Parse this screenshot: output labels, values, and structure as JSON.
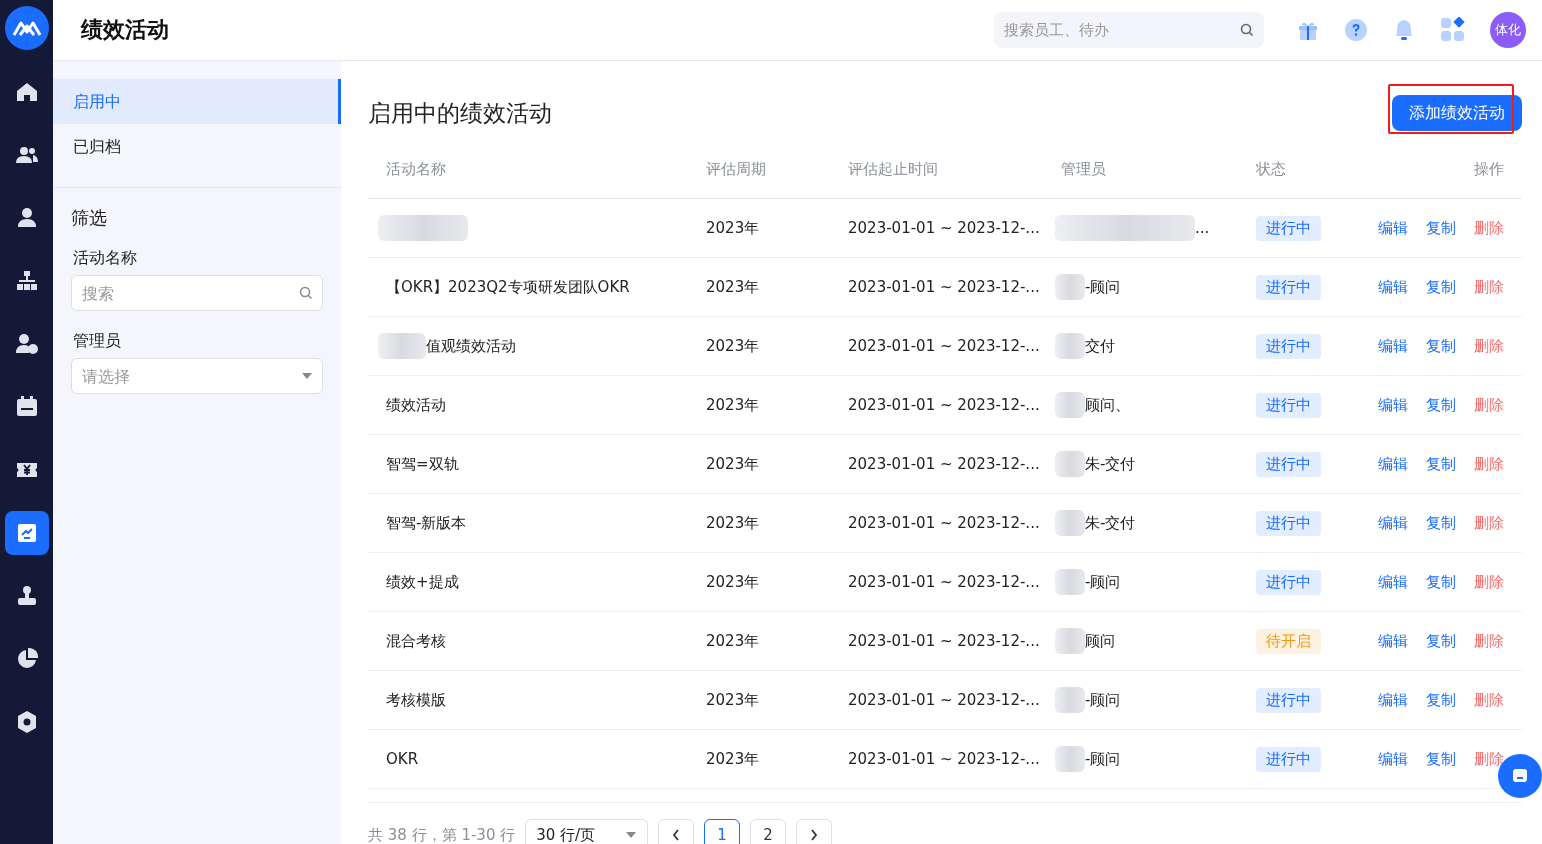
{
  "nav": [
    {
      "kind": "home",
      "selected": false
    },
    {
      "kind": "team",
      "selected": false
    },
    {
      "kind": "person",
      "selected": false
    },
    {
      "kind": "org",
      "selected": false
    },
    {
      "kind": "person-add",
      "selected": false
    },
    {
      "kind": "calendar",
      "selected": false
    },
    {
      "kind": "yen",
      "selected": false
    },
    {
      "kind": "chart",
      "selected": true
    },
    {
      "kind": "stamp",
      "selected": false
    },
    {
      "kind": "pie",
      "selected": false
    },
    {
      "kind": "settings",
      "selected": false
    }
  ],
  "header": {
    "title": "绩效活动",
    "search": {
      "placeholder": "搜索员工、待办"
    },
    "avatar": "体化"
  },
  "side_tabs": [
    {
      "label": "启用中",
      "selected": true
    },
    {
      "label": "已归档",
      "selected": false
    }
  ],
  "filter": {
    "title": "筛选",
    "name_label": "活动名称",
    "name_placeholder": "搜索",
    "admin_label": "管理员",
    "admin_placeholder": "请选择"
  },
  "main": {
    "title": "启用中的绩效活动",
    "add_button": "添加绩效活动",
    "add_button_highlighted": true
  },
  "table": {
    "columns": [
      "活动名称",
      "评估周期",
      "评估起止时间",
      "管理员",
      "状态",
      "操作"
    ],
    "rows": [
      {
        "name_blurred": true,
        "period": "2023年",
        "range": "2023-01-01 ~ 2023-12-...",
        "admin_blurred": true,
        "admin": "...",
        "status": "进行中",
        "color": "#1a6dff",
        "actions": [
          "编辑",
          "复制",
          "删除"
        ]
      },
      {
        "name_blurred": false,
        "name": "【OKR】2023Q2专项研发团队OKR",
        "period": "2023年",
        "range": "2023-01-01 ~ 2023-12-...",
        "admin_blurred": true,
        "admin": "-顾问",
        "status": "进行中",
        "color": "#1a6dff",
        "actions": [
          "编辑",
          "复制",
          "删除"
        ]
      },
      {
        "name_blurred": true,
        "name": "值观绩效活动",
        "period": "2023年",
        "range": "2023-01-01 ~ 2023-12-...",
        "admin_blurred": true,
        "admin": "交付",
        "status": "进行中",
        "color": "#1a6dff",
        "actions": [
          "编辑",
          "复制",
          "删除"
        ]
      },
      {
        "name_blurred": false,
        "name": "绩效活动",
        "period": "2023年",
        "range": "2023-01-01 ~ 2023-12-...",
        "admin_blurred": true,
        "admin": "顾问、",
        "status": "进行中",
        "color": "#1a6dff",
        "actions": [
          "编辑",
          "复制",
          "删除"
        ]
      },
      {
        "name_blurred": false,
        "name": "智驾=双轨",
        "period": "2023年",
        "range": "2023-01-01 ~ 2023-12-...",
        "admin_blurred": true,
        "admin": "朱-交付",
        "status": "进行中",
        "color": "#1a6dff",
        "actions": [
          "编辑",
          "复制",
          "删除"
        ]
      },
      {
        "name_blurred": false,
        "name": "智驾-新版本",
        "period": "2023年",
        "range": "2023-01-01 ~ 2023-12-...",
        "admin_blurred": true,
        "admin": "朱-交付",
        "status": "进行中",
        "color": "#1a6dff",
        "actions": [
          "编辑",
          "复制",
          "删除"
        ]
      },
      {
        "name_blurred": false,
        "name": "绩效+提成",
        "period": "2023年",
        "range": "2023-01-01 ~ 2023-12-...",
        "admin_blurred": true,
        "admin": "-顾问",
        "status": "进行中",
        "color": "#1a6dff",
        "actions": [
          "编辑",
          "复制",
          "删除"
        ]
      },
      {
        "name_blurred": false,
        "name": "混合考核",
        "period": "2023年",
        "range": "2023-01-01 ~ 2023-12-...",
        "admin_blurred": true,
        "admin": "顾问",
        "status": "待开启",
        "color": "#f09a10",
        "actions": [
          "编辑",
          "复制",
          "删除"
        ]
      },
      {
        "name_blurred": false,
        "name": "考核模版",
        "period": "2023年",
        "range": "2023-01-01 ~ 2023-12-...",
        "admin_blurred": true,
        "admin": "-顾问",
        "status": "进行中",
        "color": "#1a6dff",
        "actions": [
          "编辑",
          "复制",
          "删除"
        ]
      },
      {
        "name_blurred": false,
        "name": "OKR",
        "period": "2023年",
        "range": "2023-01-01 ~ 2023-12-...",
        "admin_blurred": true,
        "admin": "-顾问",
        "status": "进行中",
        "color": "#1a6dff",
        "actions": [
          "编辑",
          "复制",
          "删除"
        ]
      }
    ]
  },
  "pagination": {
    "summary": "共 38 行，第 1-30 行",
    "page_size": "30 行/页",
    "pages": [
      {
        "label": "1",
        "selected": true
      },
      {
        "label": "2",
        "selected": false
      }
    ]
  }
}
